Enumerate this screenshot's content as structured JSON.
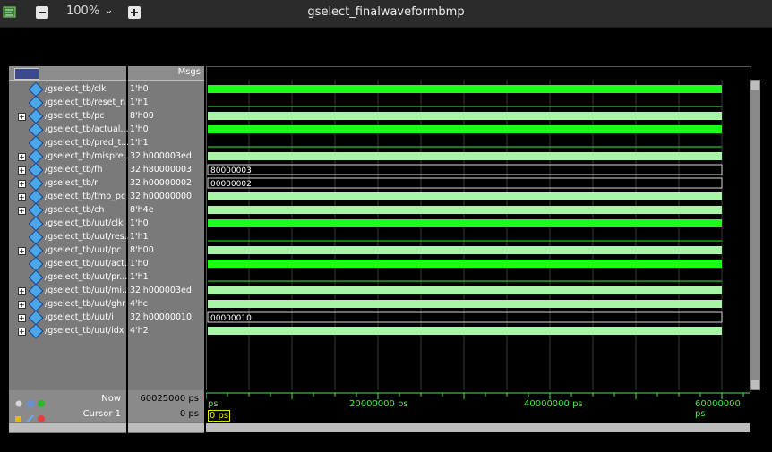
{
  "toolbar": {
    "zoom": "100%",
    "title": "gselect_finalwaveformbmp"
  },
  "header": {
    "msgs_label": "Msgs"
  },
  "signals": [
    {
      "name": "/gselect_tb/clk",
      "value": "1'h0",
      "expander": false,
      "wave": "solid"
    },
    {
      "name": "/gselect_tb/reset_n",
      "value": "1'h1",
      "expander": false,
      "wave": "low"
    },
    {
      "name": "/gselect_tb/pc",
      "value": "8'h00",
      "expander": true,
      "wave": "bus"
    },
    {
      "name": "/gselect_tb/actual...",
      "value": "1'h0",
      "expander": false,
      "wave": "solid"
    },
    {
      "name": "/gselect_tb/pred_t...",
      "value": "1'h1",
      "expander": false,
      "wave": "low"
    },
    {
      "name": "/gselect_tb/mispre...",
      "value": "32'h000003ed",
      "expander": true,
      "wave": "bus"
    },
    {
      "name": "/gselect_tb/fh",
      "value": "32'h80000003",
      "expander": true,
      "wave": "busval",
      "busval": "80000003"
    },
    {
      "name": "/gselect_tb/r",
      "value": "32'h00000002",
      "expander": true,
      "wave": "busval",
      "busval": "00000002"
    },
    {
      "name": "/gselect_tb/tmp_pc",
      "value": "32'h00000000",
      "expander": true,
      "wave": "bus"
    },
    {
      "name": "/gselect_tb/ch",
      "value": "8'h4e",
      "expander": true,
      "wave": "bus"
    },
    {
      "name": "/gselect_tb/uut/clk",
      "value": "1'h0",
      "expander": false,
      "wave": "solid"
    },
    {
      "name": "/gselect_tb/uut/res...",
      "value": "1'h1",
      "expander": false,
      "wave": "low"
    },
    {
      "name": "/gselect_tb/uut/pc",
      "value": "8'h00",
      "expander": true,
      "wave": "bus"
    },
    {
      "name": "/gselect_tb/uut/act...",
      "value": "1'h0",
      "expander": false,
      "wave": "solid"
    },
    {
      "name": "/gselect_tb/uut/pr...",
      "value": "1'h1",
      "expander": false,
      "wave": "low"
    },
    {
      "name": "/gselect_tb/uut/mi...",
      "value": "32'h000003ed",
      "expander": true,
      "wave": "bus"
    },
    {
      "name": "/gselect_tb/uut/ghr",
      "value": "4'hc",
      "expander": true,
      "wave": "bus"
    },
    {
      "name": "/gselect_tb/uut/i",
      "value": "32'h00000010",
      "expander": true,
      "wave": "busval",
      "busval": "00000010"
    },
    {
      "name": "/gselect_tb/uut/idx",
      "value": "4'h2",
      "expander": true,
      "wave": "bus"
    }
  ],
  "status": {
    "now_label": "Now",
    "now_value": "60025000 ps",
    "cursor_label": "Cursor 1",
    "cursor_value": "0 ps",
    "cursor_marker": "0 ps"
  },
  "timeline": {
    "labels": [
      "ps",
      "20000000 ps",
      "40000000 ps",
      "60000000 ps"
    ]
  },
  "colors": {
    "wave_green": "#1bff1b",
    "bus_green": "#a8f5a8",
    "timeline_green": "#46e846"
  }
}
